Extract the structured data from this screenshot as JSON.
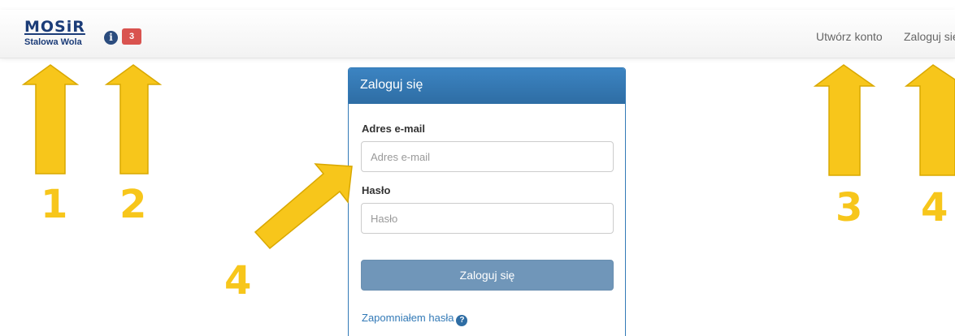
{
  "navbar": {
    "logo_text": "MOSiR",
    "logo_subtitle": "Stalowa Wola",
    "info_icon": "info-icon",
    "notification_count": "3",
    "links": {
      "create_account": "Utwórz konto",
      "login": "Zaloguj się"
    }
  },
  "login_panel": {
    "title": "Zaloguj się",
    "email_label": "Adres e-mail",
    "email_placeholder": "Adres e-mail",
    "password_label": "Hasło",
    "password_placeholder": "Hasło",
    "submit_label": "Zaloguj się",
    "forgot_label": "Zapomniałem hasła",
    "forgot_icon": "question-circle-icon"
  },
  "annotations": {
    "labels": [
      "1",
      "2",
      "3",
      "4",
      "4"
    ],
    "color": "#f7c61b"
  },
  "colors": {
    "primary": "#337ab7",
    "button": "#7096b9",
    "badge": "#d9534f",
    "logo": "#1b3c78"
  }
}
